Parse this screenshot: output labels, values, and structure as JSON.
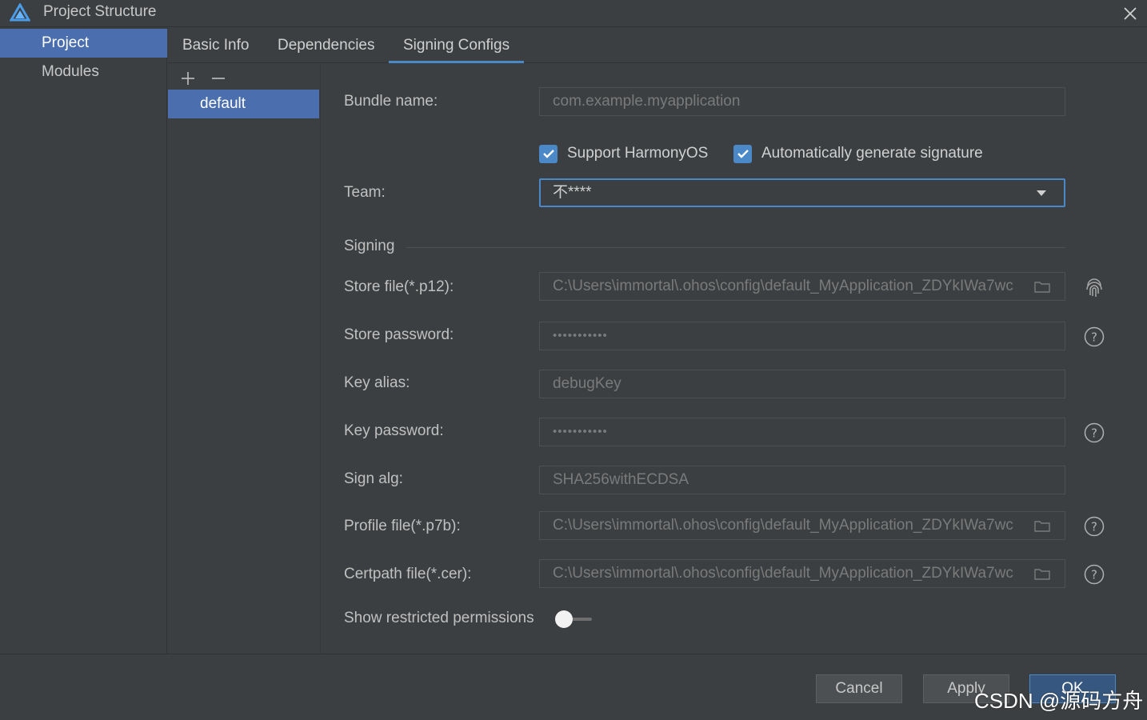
{
  "window": {
    "title": "Project Structure"
  },
  "sidebar": {
    "items": [
      {
        "label": "Project",
        "active": true
      },
      {
        "label": "Modules",
        "active": false
      }
    ]
  },
  "tabs": [
    {
      "label": "Basic Info"
    },
    {
      "label": "Dependencies"
    },
    {
      "label": "Signing Configs",
      "active": true
    }
  ],
  "config_list": {
    "items": [
      {
        "label": "default",
        "selected": true
      }
    ]
  },
  "form": {
    "bundle_name": {
      "label": "Bundle name:",
      "value": "com.example.myapplication"
    },
    "support_harmonyos": {
      "label": "Support HarmonyOS",
      "checked": true
    },
    "auto_sign": {
      "label": "Automatically generate signature",
      "checked": true
    },
    "team": {
      "label": "Team:",
      "value": "不****"
    },
    "signing_section": "Signing",
    "store_file": {
      "label": "Store file(*.p12):",
      "value": "C:\\Users\\immortal\\.ohos\\config\\default_MyApplication_ZDYkIWa7wc"
    },
    "store_password": {
      "label": "Store password:",
      "value": "•••••••••••"
    },
    "key_alias": {
      "label": "Key alias:",
      "value": "debugKey"
    },
    "key_password": {
      "label": "Key password:",
      "value": "•••••••••••"
    },
    "sign_alg": {
      "label": "Sign alg:",
      "value": "SHA256withECDSA"
    },
    "profile_file": {
      "label": "Profile file(*.p7b):",
      "value": "C:\\Users\\immortal\\.ohos\\config\\default_MyApplication_ZDYkIWa7wc"
    },
    "certpath_file": {
      "label": "Certpath file(*.cer):",
      "value": "C:\\Users\\immortal\\.ohos\\config\\default_MyApplication_ZDYkIWa7wc"
    },
    "show_restricted": {
      "label": "Show restricted permissions",
      "on": false
    }
  },
  "footer": {
    "cancel": "Cancel",
    "apply": "Apply",
    "ok": "OK"
  },
  "watermark": "CSDN @源码方舟",
  "colors": {
    "accent": "#4a88c7",
    "selection": "#4b6eaf",
    "background": "#3c3f41"
  }
}
